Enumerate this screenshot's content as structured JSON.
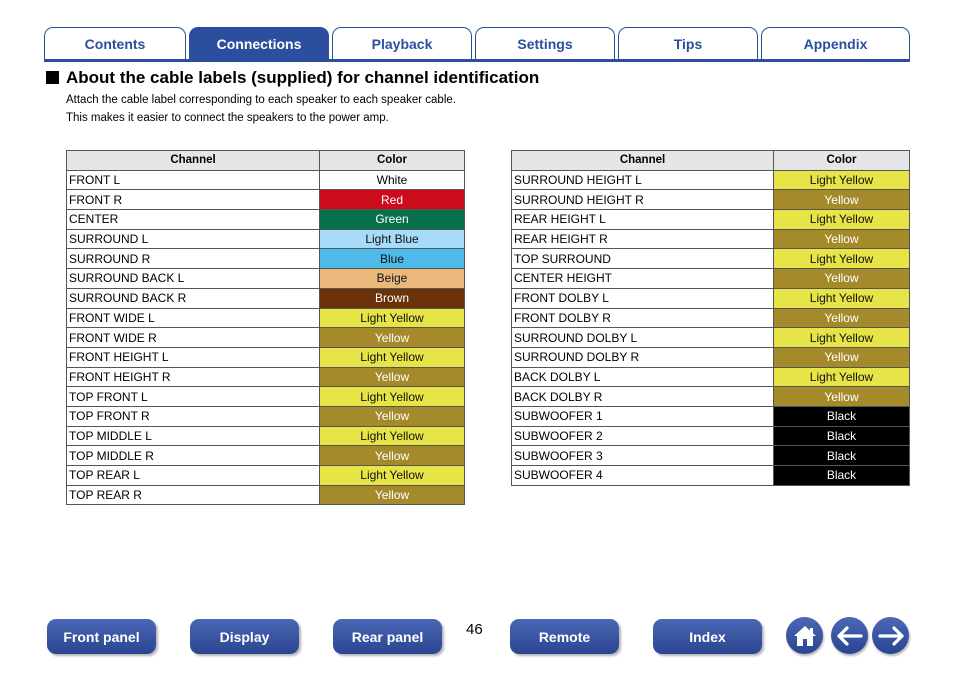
{
  "tabs": [
    "Contents",
    "Connections",
    "Playback",
    "Settings",
    "Tips",
    "Appendix"
  ],
  "active_tab": "Connections",
  "heading": "About the cable labels (supplied) for channel identification",
  "intro": [
    "Attach the cable label corresponding to each speaker to each speaker cable.",
    "This makes it easier to connect the speakers to the power amp."
  ],
  "table_headers": {
    "channel": "Channel",
    "color": "Color"
  },
  "table_left": [
    {
      "channel": "FRONT L",
      "color": "White",
      "swatch": "#ffffff"
    },
    {
      "channel": "FRONT R",
      "color": "Red",
      "swatch": "#cc0b1d"
    },
    {
      "channel": "CENTER",
      "color": "Green",
      "swatch": "#05704a"
    },
    {
      "channel": "SURROUND L",
      "color": "Light Blue",
      "swatch": "#a6dcf7"
    },
    {
      "channel": "SURROUND R",
      "color": "Blue",
      "swatch": "#4fb9ea"
    },
    {
      "channel": "SURROUND BACK L",
      "color": "Beige",
      "swatch": "#ebb87c"
    },
    {
      "channel": "SURROUND BACK R",
      "color": "Brown",
      "swatch": "#6b3209"
    },
    {
      "channel": "FRONT WIDE L",
      "color": "Light Yellow",
      "swatch": "#e6e447"
    },
    {
      "channel": "FRONT WIDE R",
      "color": "Yellow",
      "swatch": "#a58a2b"
    },
    {
      "channel": "FRONT HEIGHT L",
      "color": "Light Yellow",
      "swatch": "#e6e447"
    },
    {
      "channel": "FRONT HEIGHT R",
      "color": "Yellow",
      "swatch": "#a58a2b"
    },
    {
      "channel": "TOP FRONT L",
      "color": "Light Yellow",
      "swatch": "#e6e447"
    },
    {
      "channel": "TOP FRONT R",
      "color": "Yellow",
      "swatch": "#a58a2b"
    },
    {
      "channel": "TOP MIDDLE L",
      "color": "Light Yellow",
      "swatch": "#e6e447"
    },
    {
      "channel": "TOP MIDDLE R",
      "color": "Yellow",
      "swatch": "#a58a2b"
    },
    {
      "channel": "TOP REAR L",
      "color": "Light Yellow",
      "swatch": "#e6e447"
    },
    {
      "channel": "TOP REAR R",
      "color": "Yellow",
      "swatch": "#a58a2b"
    }
  ],
  "table_right": [
    {
      "channel": "SURROUND HEIGHT L",
      "color": "Light Yellow",
      "swatch": "#e6e447"
    },
    {
      "channel": "SURROUND HEIGHT R",
      "color": "Yellow",
      "swatch": "#a58a2b"
    },
    {
      "channel": "REAR HEIGHT L",
      "color": "Light Yellow",
      "swatch": "#e6e447"
    },
    {
      "channel": "REAR HEIGHT R",
      "color": "Yellow",
      "swatch": "#a58a2b"
    },
    {
      "channel": "TOP SURROUND",
      "color": "Light Yellow",
      "swatch": "#e6e447"
    },
    {
      "channel": "CENTER HEIGHT",
      "color": "Yellow",
      "swatch": "#a58a2b"
    },
    {
      "channel": "FRONT DOLBY L",
      "color": "Light Yellow",
      "swatch": "#e6e447"
    },
    {
      "channel": "FRONT DOLBY R",
      "color": "Yellow",
      "swatch": "#a58a2b"
    },
    {
      "channel": "SURROUND DOLBY L",
      "color": "Light Yellow",
      "swatch": "#e6e447"
    },
    {
      "channel": "SURROUND DOLBY R",
      "color": "Yellow",
      "swatch": "#a58a2b"
    },
    {
      "channel": "BACK DOLBY L",
      "color": "Light Yellow",
      "swatch": "#e6e447"
    },
    {
      "channel": "BACK DOLBY R",
      "color": "Yellow",
      "swatch": "#a58a2b"
    },
    {
      "channel": "SUBWOOFER 1",
      "color": "Black",
      "swatch": "#000000"
    },
    {
      "channel": "SUBWOOFER 2",
      "color": "Black",
      "swatch": "#000000"
    },
    {
      "channel": "SUBWOOFER 3",
      "color": "Black",
      "swatch": "#000000"
    },
    {
      "channel": "SUBWOOFER 4",
      "color": "Black",
      "swatch": "#000000"
    }
  ],
  "bottom_nav": [
    "Front panel",
    "Display",
    "Rear panel",
    "Remote",
    "Index"
  ],
  "page_number": "46",
  "icons": [
    "home-icon",
    "back-arrow-icon",
    "forward-arrow-icon"
  ],
  "accent_color": "#2b4f9e"
}
